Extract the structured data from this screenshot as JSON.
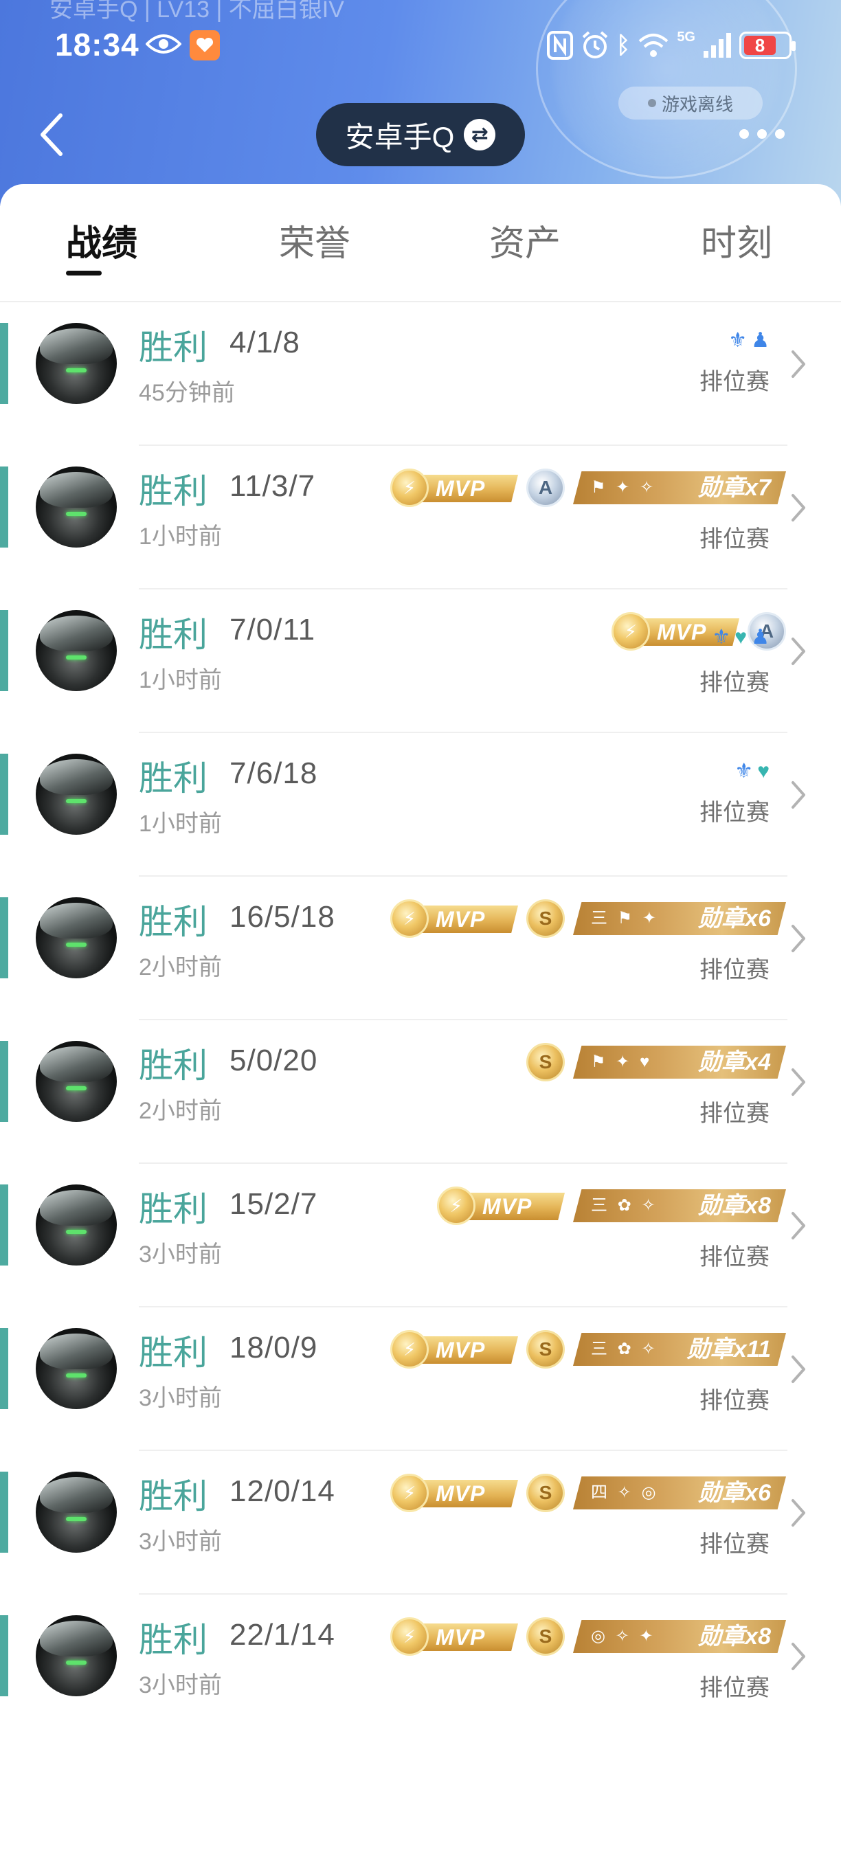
{
  "status_bar": {
    "time": "18:34",
    "battery": "8",
    "network": "5G",
    "icons": [
      "eye-icon",
      "app-notification-icon",
      "nfc-icon",
      "alarm-icon",
      "bluetooth-icon",
      "wifi-icon",
      "signal-icon",
      "battery-icon"
    ]
  },
  "header": {
    "faded_name": "安卓手Q | LV13 | 不屈白银IV",
    "account_name": "安卓手Q",
    "offline_status": "游戏离线",
    "colors": {
      "gradient_start": "#4c77dd",
      "gradient_end": "#b9d6ee",
      "account_pill": "#213148"
    }
  },
  "tabs": [
    {
      "label": "战绩",
      "active": true
    },
    {
      "label": "荣誉",
      "active": false
    },
    {
      "label": "资产",
      "active": false
    },
    {
      "label": "时刻",
      "active": false
    }
  ],
  "colors": {
    "win": "#4aa59b",
    "accent_bar": "#4eaaa0",
    "role_icon_blue": "#3f86e8",
    "role_icon_teal": "#37b5b0",
    "medal_gold": "#d3a25a"
  },
  "matches": [
    {
      "result": "胜利",
      "kda": "4/1/8",
      "time_ago": "45分钟前",
      "mode": "排位赛",
      "mvp": false,
      "grade": null,
      "medal": null,
      "roles": [
        "wings-icon",
        "pawn-icon"
      ]
    },
    {
      "result": "胜利",
      "kda": "11/3/7",
      "time_ago": "1小时前",
      "mode": "排位赛",
      "mvp": true,
      "mvp_label": "MVP",
      "grade": "A",
      "medal": {
        "label": "勋章",
        "count": "x7",
        "icons": "⚑ ✦ ✧"
      },
      "roles": []
    },
    {
      "result": "胜利",
      "kda": "7/0/11",
      "time_ago": "1小时前",
      "mode": "排位赛",
      "mvp": true,
      "mvp_label": "MVP",
      "grade": "A",
      "medal": null,
      "roles": [
        "wings-icon",
        "heart-icon",
        "pawn-icon"
      ]
    },
    {
      "result": "胜利",
      "kda": "7/6/18",
      "time_ago": "1小时前",
      "mode": "排位赛",
      "mvp": false,
      "grade": null,
      "medal": null,
      "roles": [
        "wings-icon",
        "heart-icon"
      ]
    },
    {
      "result": "胜利",
      "kda": "16/5/18",
      "time_ago": "2小时前",
      "mode": "排位赛",
      "mvp": true,
      "mvp_label": "MVP",
      "grade": "S",
      "medal": {
        "label": "勋章",
        "count": "x6",
        "icons": "三 ⚑ ✦"
      },
      "roles": []
    },
    {
      "result": "胜利",
      "kda": "5/0/20",
      "time_ago": "2小时前",
      "mode": "排位赛",
      "mvp": false,
      "grade": "S",
      "medal": {
        "label": "勋章",
        "count": "x4",
        "icons": "⚑ ✦ ♥"
      },
      "roles": []
    },
    {
      "result": "胜利",
      "kda": "15/2/7",
      "time_ago": "3小时前",
      "mode": "排位赛",
      "mvp": true,
      "mvp_label": "MVP",
      "grade": null,
      "medal": {
        "label": "勋章",
        "count": "x8",
        "icons": "三 ✿ ✧"
      },
      "roles": []
    },
    {
      "result": "胜利",
      "kda": "18/0/9",
      "time_ago": "3小时前",
      "mode": "排位赛",
      "mvp": true,
      "mvp_label": "MVP",
      "grade": "S",
      "medal": {
        "label": "勋章",
        "count": "x11",
        "icons": "三 ✿ ✧"
      },
      "roles": []
    },
    {
      "result": "胜利",
      "kda": "12/0/14",
      "time_ago": "3小时前",
      "mode": "排位赛",
      "mvp": true,
      "mvp_label": "MVP",
      "grade": "S",
      "medal": {
        "label": "勋章",
        "count": "x6",
        "icons": "四 ✧ ◎"
      },
      "roles": []
    },
    {
      "result": "胜利",
      "kda": "22/1/14",
      "time_ago": "3小时前",
      "mode": "排位赛",
      "mvp": true,
      "mvp_label": "MVP",
      "grade": "S",
      "medal": {
        "label": "勋章",
        "count": "x8",
        "icons": "◎ ✧ ✦"
      },
      "roles": []
    }
  ]
}
